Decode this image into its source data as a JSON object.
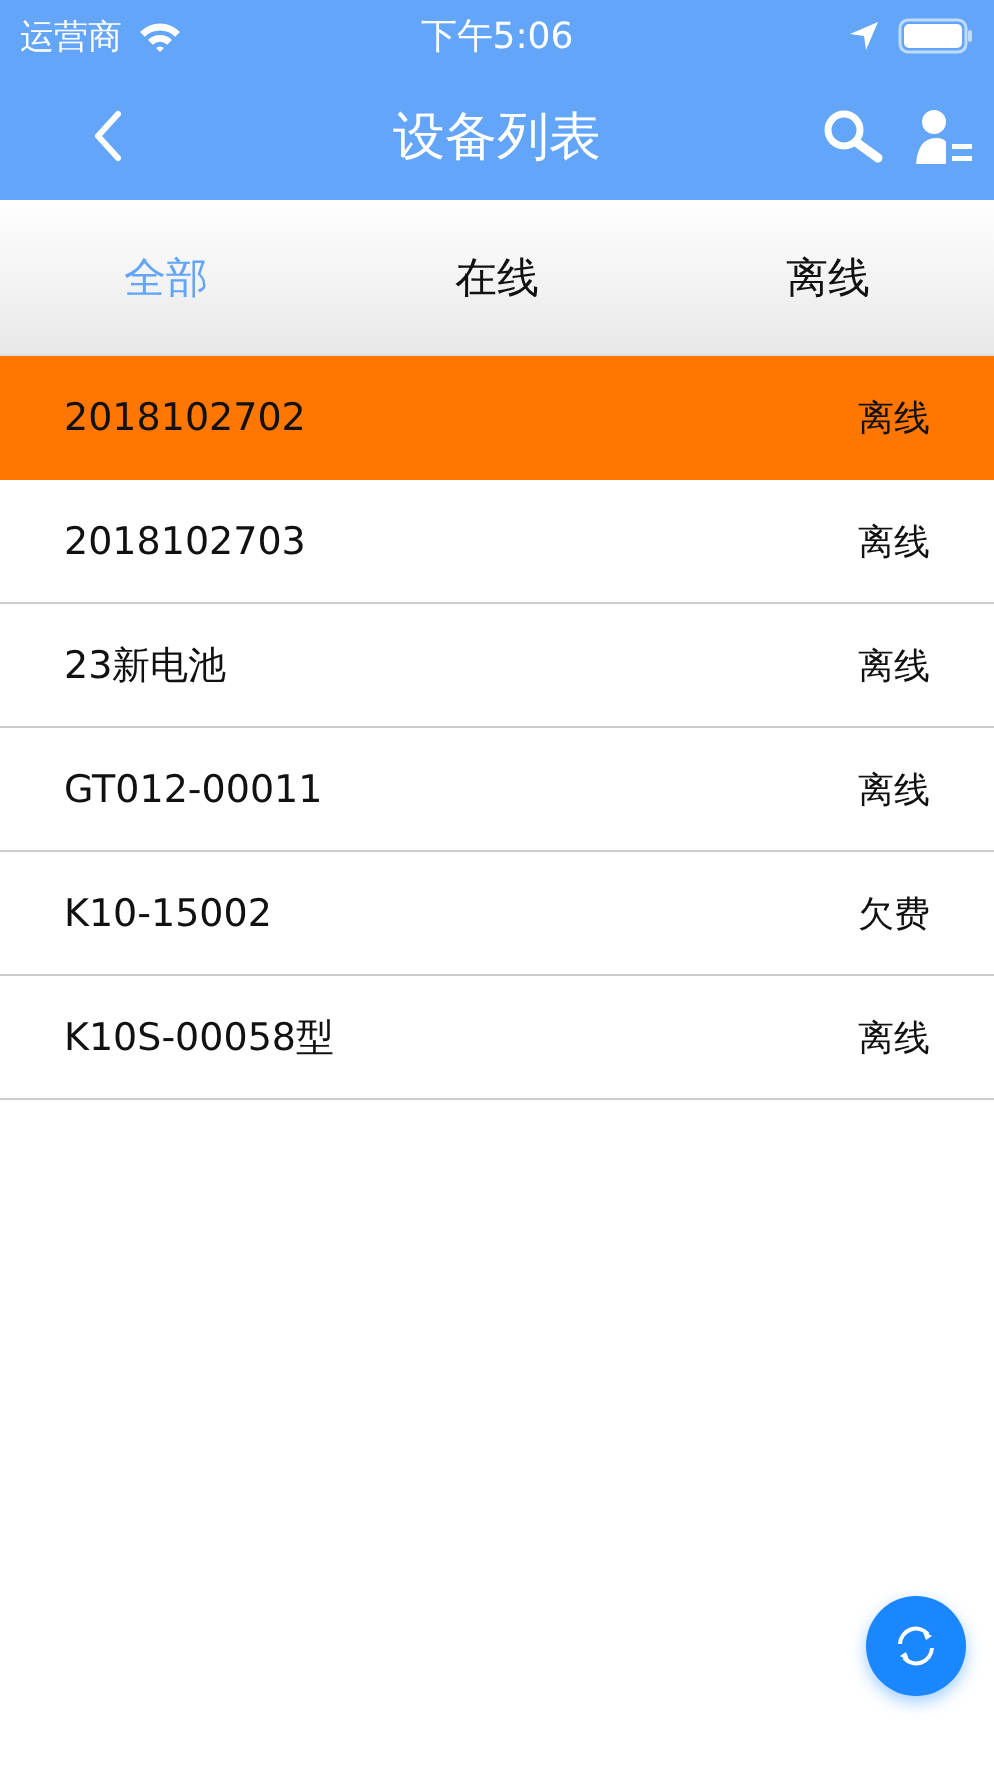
{
  "status_bar": {
    "carrier": "运营商",
    "time": "下午5:06"
  },
  "header": {
    "title": "设备列表"
  },
  "tabs": [
    {
      "label": "全部",
      "selected": true
    },
    {
      "label": "在线",
      "selected": false
    },
    {
      "label": "离线",
      "selected": false
    }
  ],
  "devices": [
    {
      "name": "2018102702",
      "status": "离线",
      "selected": true
    },
    {
      "name": "2018102703",
      "status": "离线",
      "selected": false
    },
    {
      "name": "23新电池",
      "status": "离线",
      "selected": false
    },
    {
      "name": "GT012-00011",
      "status": "离线",
      "selected": false
    },
    {
      "name": "K10-15002",
      "status": "欠费",
      "selected": false
    },
    {
      "name": "K10S-00058型",
      "status": "离线",
      "selected": false
    }
  ]
}
